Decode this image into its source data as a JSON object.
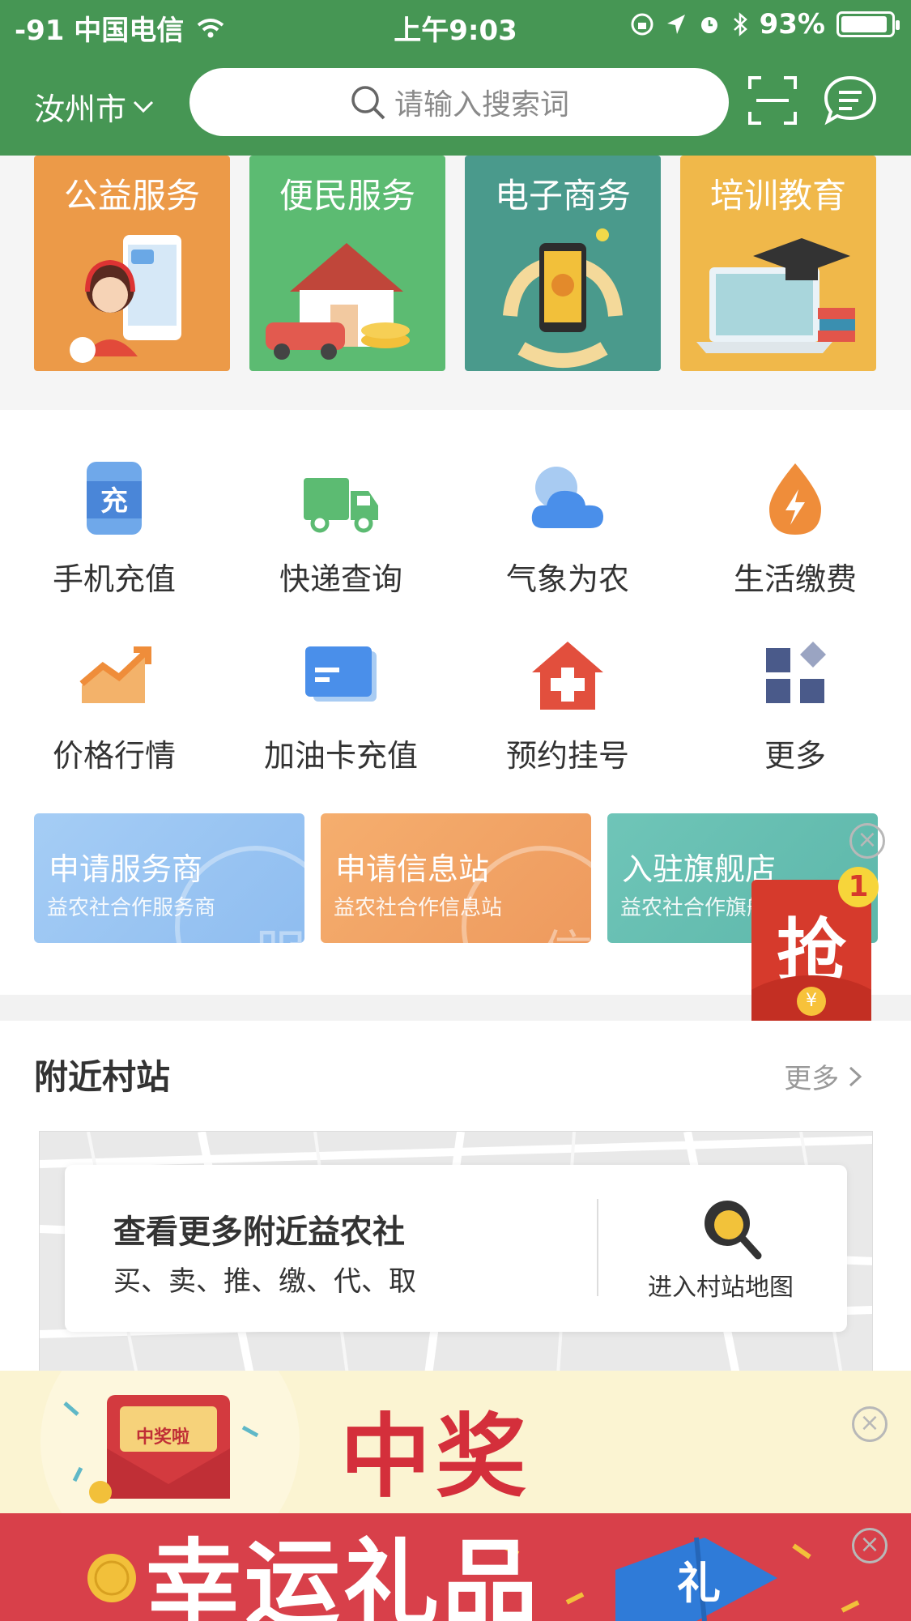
{
  "status": {
    "signal": "-91 中国电信",
    "time": "上午9:03",
    "battery": "93%",
    "battery_level": 0.93
  },
  "header": {
    "city": "汝州市",
    "search_placeholder": "请输入搜索词"
  },
  "categories": [
    {
      "label": "公益服务",
      "color": "#ec9a48"
    },
    {
      "label": "便民服务",
      "color": "#5cbb72"
    },
    {
      "label": "电子商务",
      "color": "#4a9a8c"
    },
    {
      "label": "培训教育",
      "color": "#f0b84a"
    }
  ],
  "grid": [
    {
      "label": "手机充值",
      "icon": "phone-recharge-icon"
    },
    {
      "label": "快递查询",
      "icon": "truck-icon"
    },
    {
      "label": "气象为农",
      "icon": "weather-icon"
    },
    {
      "label": "生活缴费",
      "icon": "bolt-drop-icon"
    },
    {
      "label": "价格行情",
      "icon": "trend-chart-icon"
    },
    {
      "label": "加油卡充值",
      "icon": "card-icon"
    },
    {
      "label": "预约挂号",
      "icon": "hospital-icon"
    },
    {
      "label": "更多",
      "icon": "more-grid-icon"
    }
  ],
  "promos": [
    {
      "title": "申请服务商",
      "sub": "益农社合作服务商",
      "watermark": "服"
    },
    {
      "title": "申请信息站",
      "sub": "益农社合作信息站",
      "watermark": "信"
    },
    {
      "title": "入驻旗舰店",
      "sub": "益农社合作旗舰店"
    }
  ],
  "grab": {
    "label": "抢",
    "badge": "1",
    "coin": "¥"
  },
  "nearby": {
    "title": "附近村站",
    "more": "更多",
    "card_title": "查看更多附近益农社",
    "card_sub": "买、卖、推、缴、代、取",
    "card_button": "进入村站地图"
  },
  "banners": {
    "win_text": "中奖啦！！！",
    "envelope_text": "中奖啦",
    "gift_text": "幸运礼品",
    "gift_box": "礼"
  }
}
